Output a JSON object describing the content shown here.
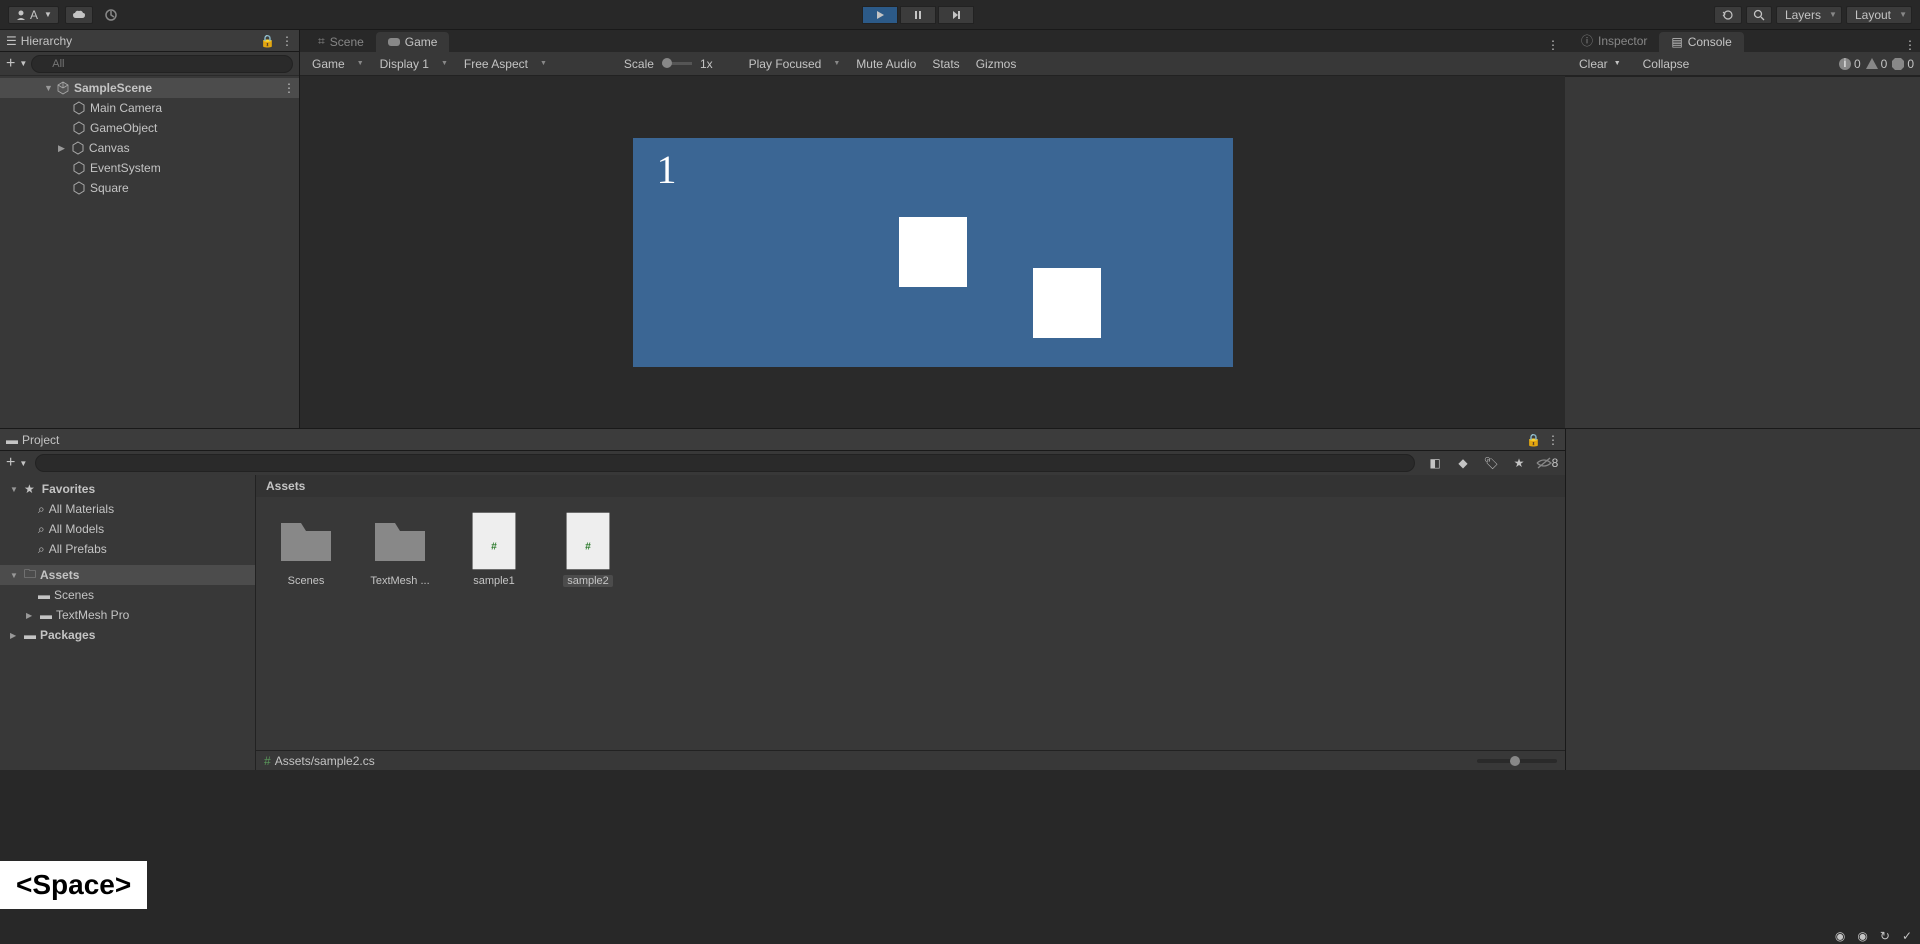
{
  "toolbar": {
    "account": "A",
    "layers_label": "Layers",
    "layout_label": "Layout"
  },
  "hierarchy": {
    "title": "Hierarchy",
    "search_placeholder": "All",
    "root": "SampleScene",
    "items": [
      "Main Camera",
      "GameObject",
      "Canvas",
      "EventSystem",
      "Square"
    ]
  },
  "scene": {
    "tab_scene": "Scene",
    "tab_game": "Game",
    "dropdown_game": "Game",
    "dropdown_display": "Display 1",
    "dropdown_aspect": "Free Aspect",
    "scale_label": "Scale",
    "scale_value": "1x",
    "play_focus": "Play Focused",
    "mute": "Mute Audio",
    "stats": "Stats",
    "gizmos": "Gizmos",
    "game_number": "1"
  },
  "inspector": {
    "tab_inspector": "Inspector",
    "tab_console": "Console",
    "clear": "Clear",
    "collapse": "Collapse",
    "count_info": "0",
    "count_warn": "0",
    "count_error": "0"
  },
  "project": {
    "title": "Project",
    "favorites": "Favorites",
    "fav_items": [
      "All Materials",
      "All Models",
      "All Prefabs"
    ],
    "assets": "Assets",
    "asset_tree": [
      "Scenes",
      "TextMesh Pro"
    ],
    "packages": "Packages",
    "breadcrumb": "Assets",
    "items": [
      {
        "name": "Scenes",
        "type": "folder"
      },
      {
        "name": "TextMesh ...",
        "type": "folder"
      },
      {
        "name": "sample1",
        "type": "script"
      },
      {
        "name": "sample2",
        "type": "script"
      }
    ],
    "hidden_count": "8"
  },
  "footer": {
    "path": "Assets/sample2.cs"
  },
  "overlay": "<Space>"
}
